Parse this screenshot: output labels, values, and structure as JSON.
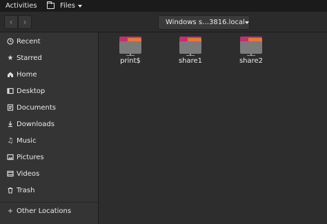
{
  "topbar": {
    "activities": "Activities",
    "app_name": "Files"
  },
  "header": {
    "back_glyph": "‹",
    "forward_glyph": "›",
    "location": "Windows s…3816.local"
  },
  "sidebar": {
    "items": [
      {
        "label": "Recent",
        "icon": "clock-icon"
      },
      {
        "label": "Starred",
        "icon": "star-icon"
      },
      {
        "label": "Home",
        "icon": "home-icon"
      },
      {
        "label": "Desktop",
        "icon": "desktop-icon"
      },
      {
        "label": "Documents",
        "icon": "document-icon"
      },
      {
        "label": "Downloads",
        "icon": "download-icon"
      },
      {
        "label": "Music",
        "icon": "music-icon"
      },
      {
        "label": "Pictures",
        "icon": "picture-icon"
      },
      {
        "label": "Videos",
        "icon": "video-icon"
      },
      {
        "label": "Trash",
        "icon": "trash-icon"
      },
      {
        "label": "Other Locations",
        "icon": "plus-icon"
      }
    ]
  },
  "files": [
    {
      "name": "print$"
    },
    {
      "name": "share1"
    },
    {
      "name": "share2"
    }
  ],
  "colors": {
    "folder_magenta": "#c4306c",
    "folder_orange": "#e07a3b",
    "folder_gray": "#7b7b7b"
  }
}
